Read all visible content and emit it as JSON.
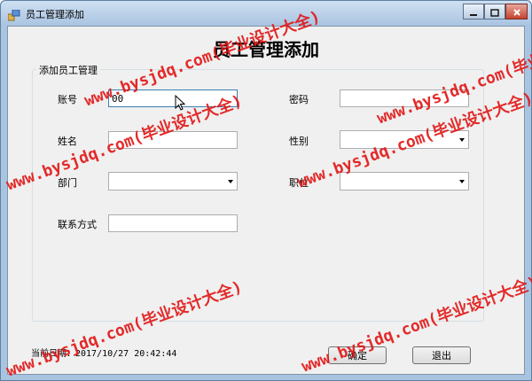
{
  "window": {
    "title": "员工管理添加"
  },
  "form": {
    "heading": "员工管理添加",
    "group_label": "添加员工管理",
    "fields": {
      "account_label": "账号",
      "account_value": "00",
      "password_label": "密码",
      "password_value": "",
      "name_label": "姓名",
      "name_value": "",
      "gender_label": "性别",
      "gender_value": "",
      "department_label": "部门",
      "department_value": "",
      "position_label": "职位",
      "position_value": "",
      "contact_label": "联系方式",
      "contact_value": ""
    }
  },
  "footer": {
    "date_text": "当前日期：2017/10/27 20:42:44",
    "confirm_label": "确定",
    "exit_label": "退出"
  },
  "watermark_text": "www.bysjdq.com(毕业设计大全)",
  "icons": {
    "app": "app-icon",
    "minimize": "minimize-icon",
    "maximize": "maximize-icon",
    "close": "close-icon",
    "cursor": "mouse-cursor-icon"
  },
  "colors": {
    "watermark": "#e11414",
    "titlebar": "#a9c4e0",
    "close_button": "#c4422e"
  }
}
